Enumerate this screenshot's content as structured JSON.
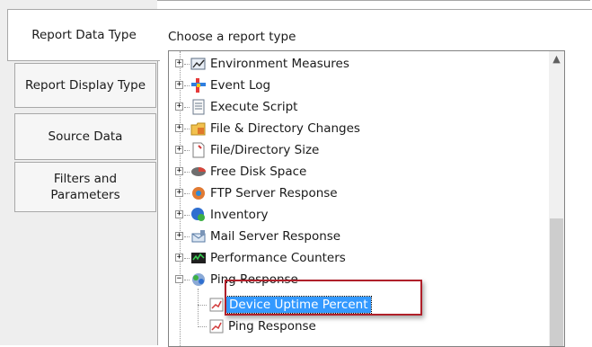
{
  "tabs": [
    {
      "label": "Report Data Type",
      "active": true
    },
    {
      "label": "Report Display Type",
      "active": false
    },
    {
      "label": "Source Data",
      "active": false
    },
    {
      "label": "Filters and Parameters",
      "active": false
    }
  ],
  "heading": "Choose a report type",
  "tree": {
    "items": [
      {
        "label": "Environment Measures",
        "icon": "environment-gauge-icon",
        "expanded": false
      },
      {
        "label": "Event Log",
        "icon": "event-log-icon",
        "expanded": false
      },
      {
        "label": "Execute Script",
        "icon": "script-icon",
        "expanded": false
      },
      {
        "label": "File & Directory Changes",
        "icon": "folder-changes-icon",
        "expanded": false
      },
      {
        "label": "File/Directory Size",
        "icon": "file-size-icon",
        "expanded": false
      },
      {
        "label": "Free Disk Space",
        "icon": "disk-space-icon",
        "expanded": false
      },
      {
        "label": "FTP Server Response",
        "icon": "ftp-server-icon",
        "expanded": false
      },
      {
        "label": "Inventory",
        "icon": "inventory-icon",
        "expanded": false
      },
      {
        "label": "Mail Server Response",
        "icon": "mail-server-icon",
        "expanded": false
      },
      {
        "label": "Performance Counters",
        "icon": "performance-counter-icon",
        "expanded": false
      },
      {
        "label": "Ping Response",
        "icon": "ping-response-icon",
        "expanded": true
      }
    ],
    "children": [
      {
        "label": "Device Uptime Percent",
        "icon": "report-chart-icon",
        "selected": true
      },
      {
        "label": "Ping Response",
        "icon": "report-chart-icon",
        "selected": false
      }
    ]
  },
  "colors": {
    "selection": "#3399ff",
    "callout_border": "#b0202a"
  }
}
